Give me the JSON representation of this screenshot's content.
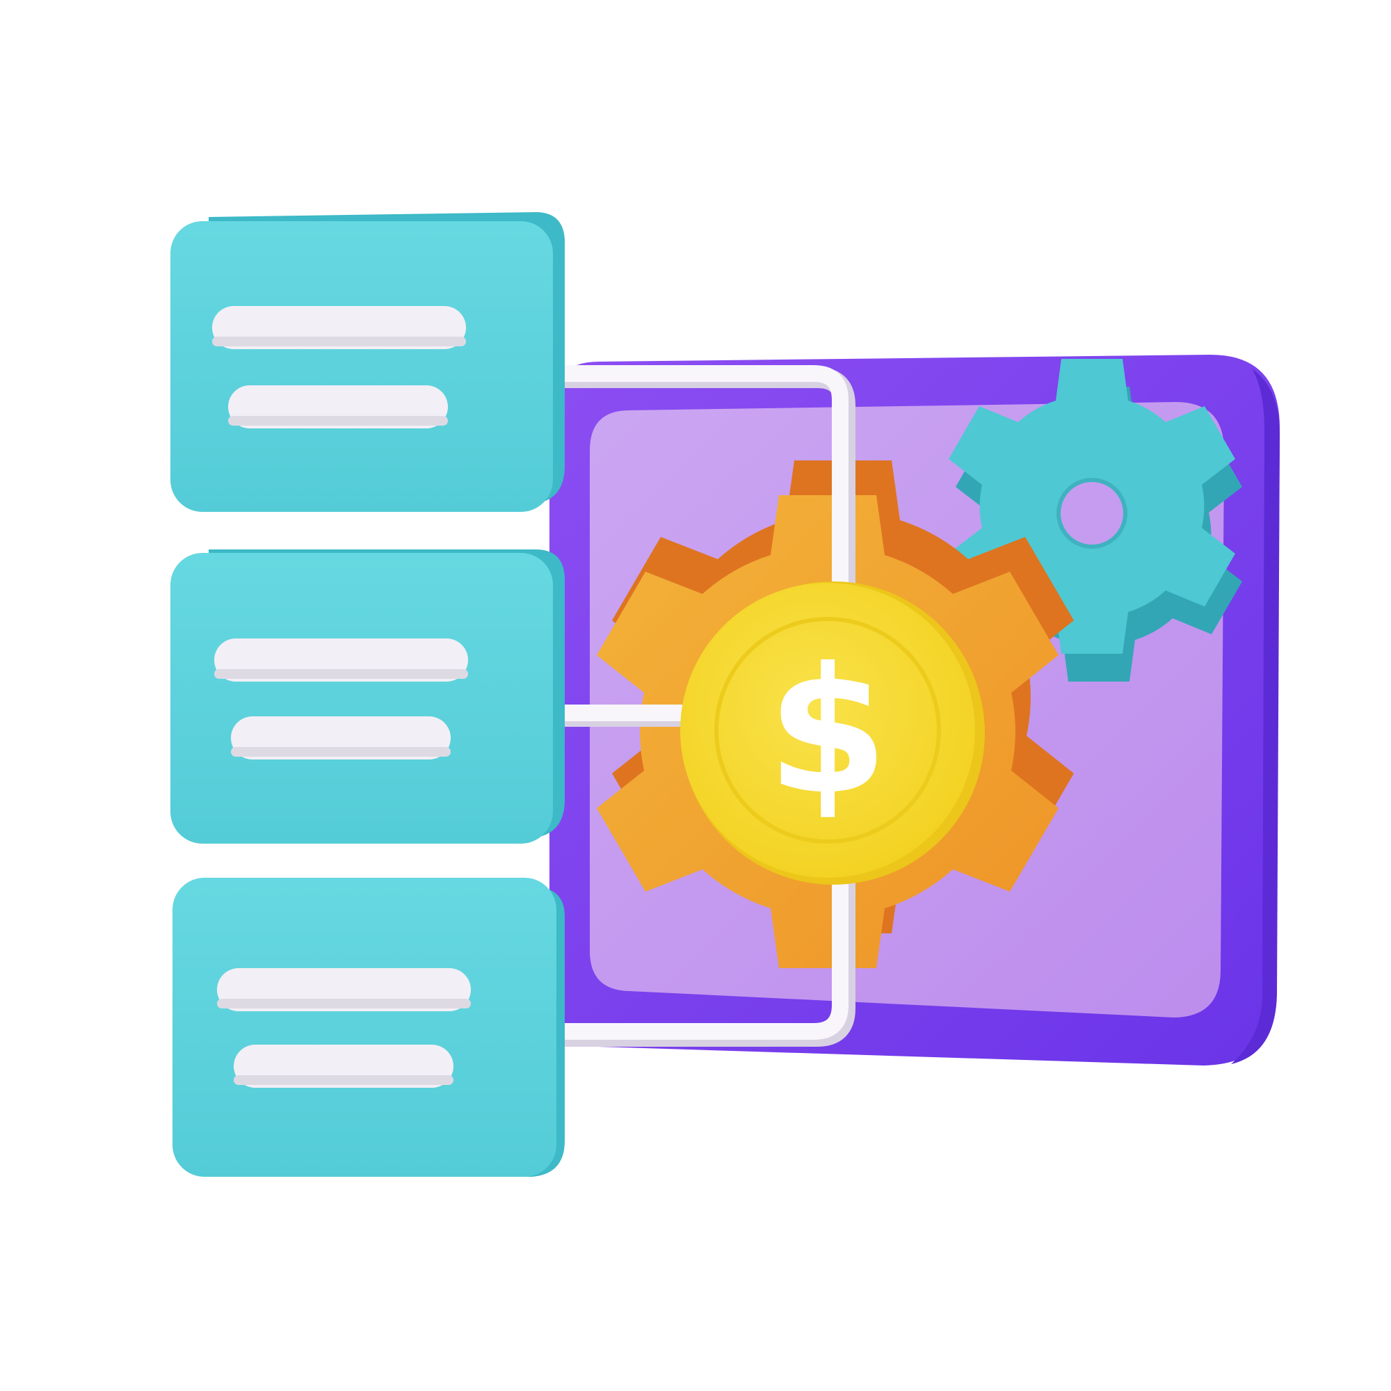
{
  "illustration": {
    "coin_symbol": "$"
  },
  "colors": {
    "background": "#ffffff",
    "card_face": "#62d5df",
    "card_side": "#3bb8c6",
    "card_line": "#f3eff6",
    "panel_frame": "#7439ea",
    "panel_frame_light": "#8d4ef2",
    "panel_inner": "#c79df0",
    "connector": "#f7f4fa",
    "connector_shade": "#dcd6e4",
    "gear_large": "#f2a531",
    "gear_large_side": "#e0781f",
    "gear_small": "#4ec8d3",
    "gear_small_side": "#35a9b8",
    "coin": "#f6db2c",
    "coin_rim": "#f1ce1f",
    "coin_symbol": "#ffffff"
  },
  "icons": [
    "document-card-icon",
    "document-card-icon",
    "document-card-icon",
    "gear-icon",
    "gear-icon",
    "dollar-coin-icon",
    "dashboard-panel-icon"
  ]
}
